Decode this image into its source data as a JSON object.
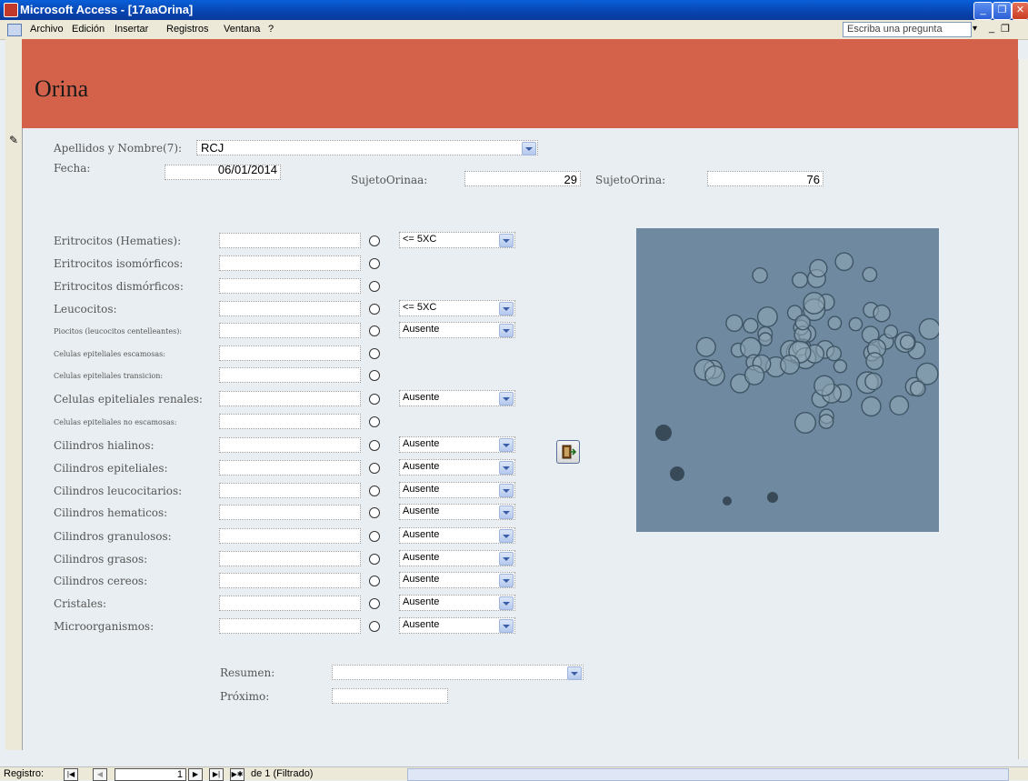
{
  "window": {
    "title": "Microsoft Access - [17aaOrina]"
  },
  "menu": {
    "items": [
      "Archivo",
      "Edición",
      "Insertar",
      "Registros",
      "Ventana",
      "?"
    ],
    "ask_placeholder": "Escriba una pregunta"
  },
  "form": {
    "header_title": "Orina",
    "apellidos_label": "Apellidos y Nombre(7):",
    "apellidos_value": "RCJ",
    "fecha_label": "Fecha:",
    "fecha_value": "06/01/2014",
    "sujetoorinaa_label": "SujetoOrinaa:",
    "sujetoorinaa_value": "29",
    "sujetoorina_label": "SujetoOrina:",
    "sujetoorina_value": "76",
    "rows": [
      {
        "label": "Eritrocitos (Hematies):",
        "combo": "<= 5XC"
      },
      {
        "label": "Eritrocitos isomórficos:",
        "combo": null
      },
      {
        "label": "Eritrocitos dismórficos:",
        "combo": null
      },
      {
        "label": "Leucocitos:",
        "combo": "<= 5XC"
      },
      {
        "label": "Piocitos (leucocitos centelleantes):",
        "combo": "Ausente"
      },
      {
        "label": "Celulas epiteliales escamosas:",
        "combo": null
      },
      {
        "label": "Celulas epiteliales transicion:",
        "combo": null
      },
      {
        "label": "Celulas epiteliales renales:",
        "combo": "Ausente"
      },
      {
        "label": "Celulas epiteliales no escamosas:",
        "combo": null
      },
      {
        "label": "Cilindros hialinos:",
        "combo": "Ausente"
      },
      {
        "label": "Cilindros epiteliales:",
        "combo": "Ausente"
      },
      {
        "label": "Cilindros leucocitarios:",
        "combo": "Ausente"
      },
      {
        "label": "Cilindros hematicos:",
        "combo": "Ausente"
      },
      {
        "label": " Cilindros granulosos:",
        "combo": "Ausente"
      },
      {
        "label": "Cilindros grasos:",
        "combo": "Ausente"
      },
      {
        "label": "Cilindros cereos:",
        "combo": "Ausente"
      },
      {
        "label": "Cristales:",
        "combo": "Ausente"
      },
      {
        "label": "Microorganismos:",
        "combo": "Ausente"
      }
    ],
    "resumen_label": "Resumen:",
    "proximo_label": "Próximo:"
  },
  "nav": {
    "label": "Registro:",
    "current": "1",
    "total": "de 1 (Filtrado)"
  },
  "colors": {
    "header": "#d4624a",
    "form_bg": "#e8eef2",
    "titlebar": "#0a5fd8"
  }
}
